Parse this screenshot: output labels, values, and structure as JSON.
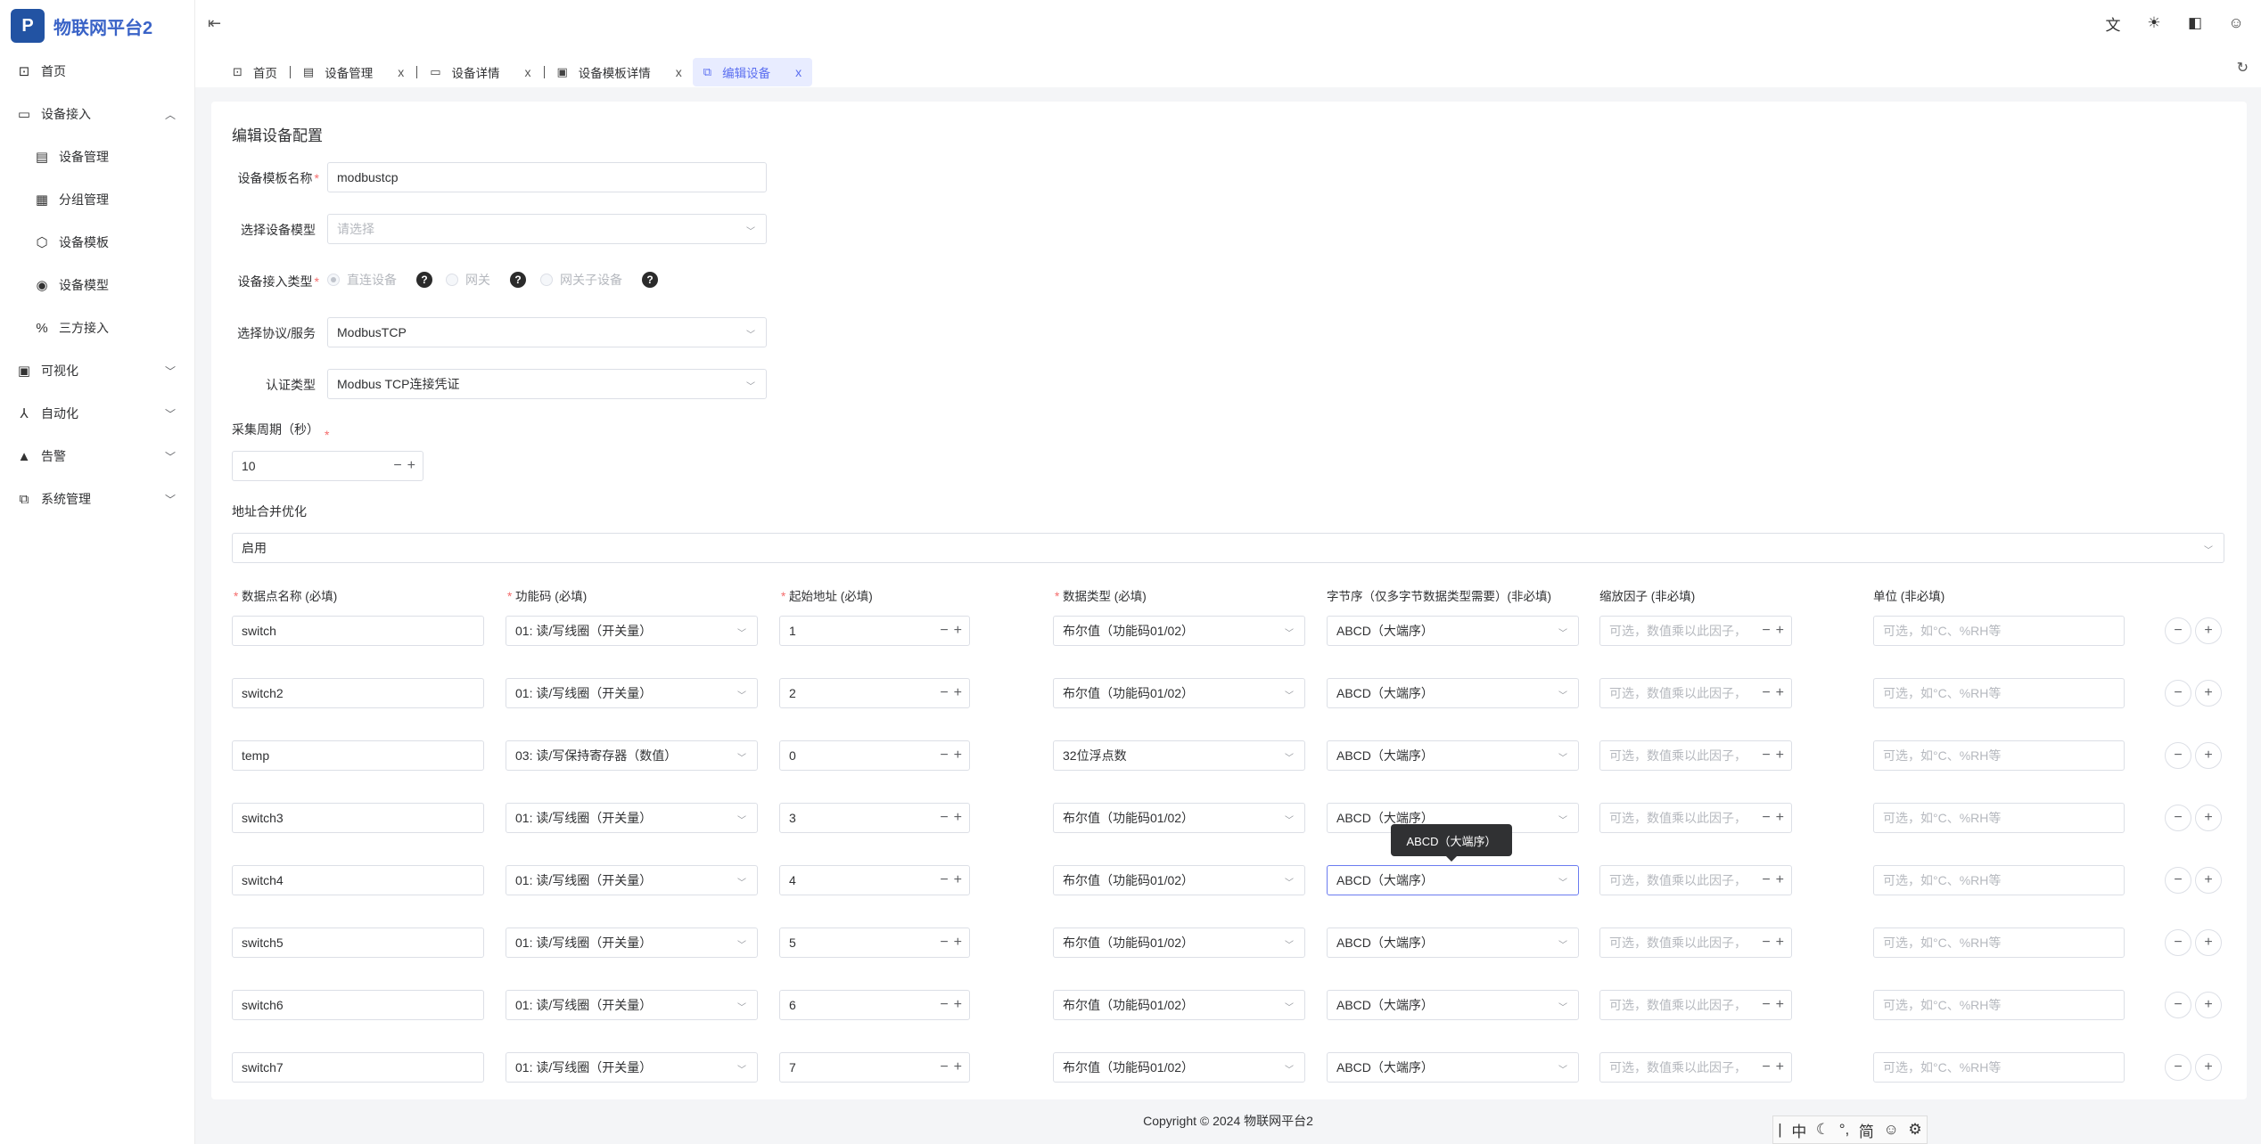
{
  "app": {
    "logo_glyph": "P",
    "title": "物联网平台2",
    "brand_color": "#3a63c7"
  },
  "sidebar": {
    "home": "首页",
    "device_access": "设备接入",
    "device_mgmt": "设备管理",
    "group_mgmt": "分组管理",
    "device_template": "设备模板",
    "device_model": "设备模型",
    "third_party": "三方接入",
    "visualization": "可视化",
    "automation": "自动化",
    "alarm": "告警",
    "system": "系统管理"
  },
  "tabs": [
    {
      "label": "首页",
      "icon": "home-icon"
    },
    {
      "label": "设备管理",
      "icon": "monitor-icon"
    },
    {
      "label": "设备详情",
      "icon": "device-icon"
    },
    {
      "label": "设备模板详情",
      "icon": "template-icon"
    },
    {
      "label": "编辑设备",
      "icon": "edit-device-icon"
    }
  ],
  "close_glyph": "x",
  "form": {
    "title": "编辑设备配置",
    "template_name_label": "设备模板名称",
    "template_name_value": "modbustcp",
    "model_label": "选择设备模型",
    "model_placeholder": "请选择",
    "access_type_label": "设备接入类型",
    "access_options": [
      "直连设备",
      "网关",
      "网关子设备"
    ],
    "protocol_label": "选择协议/服务",
    "protocol_value": "ModbusTCP",
    "auth_label": "认证类型",
    "auth_value": "Modbus TCP连接凭证",
    "period_label": "采集周期（秒）",
    "period_value": "10",
    "merge_label": "地址合并优化",
    "merge_value": "启用",
    "required_mark": "*",
    "help_glyph": "?"
  },
  "columns": {
    "name": "数据点名称 (必填)",
    "func": "功能码 (必填)",
    "addr": "起始地址 (必填)",
    "dtype": "数据类型 (必填)",
    "byteorder": "字节序（仅多字节数据类型需要）(非必填)",
    "scale": "缩放因子 (非必填)",
    "unit": "单位 (非必填)"
  },
  "placeholders": {
    "scale": "可选，数值乘以此因子，",
    "unit": "可选，如°C、%RH等"
  },
  "rows": [
    {
      "name": "switch",
      "func": "01: 读/写线圈（开关量）",
      "addr": "1",
      "dtype": "布尔值（功能码01/02）",
      "byteorder": "ABCD（大端序）"
    },
    {
      "name": "switch2",
      "func": "01: 读/写线圈（开关量）",
      "addr": "2",
      "dtype": "布尔值（功能码01/02）",
      "byteorder": "ABCD（大端序）"
    },
    {
      "name": "temp",
      "func": "03: 读/写保持寄存器（数值）",
      "addr": "0",
      "dtype": "32位浮点数",
      "byteorder": "ABCD（大端序）"
    },
    {
      "name": "switch3",
      "func": "01: 读/写线圈（开关量）",
      "addr": "3",
      "dtype": "布尔值（功能码01/02）",
      "byteorder": "ABCD（大端序）"
    },
    {
      "name": "switch4",
      "func": "01: 读/写线圈（开关量）",
      "addr": "4",
      "dtype": "布尔值（功能码01/02）",
      "byteorder": "ABCD（大端序）"
    },
    {
      "name": "switch5",
      "func": "01: 读/写线圈（开关量）",
      "addr": "5",
      "dtype": "布尔值（功能码01/02）",
      "byteorder": "ABCD（大端序）"
    },
    {
      "name": "switch6",
      "func": "01: 读/写线圈（开关量）",
      "addr": "6",
      "dtype": "布尔值（功能码01/02）",
      "byteorder": "ABCD（大端序）"
    },
    {
      "name": "switch7",
      "func": "01: 读/写线圈（开关量）",
      "addr": "7",
      "dtype": "布尔值（功能码01/02）",
      "byteorder": "ABCD（大端序）"
    }
  ],
  "tooltip": "ABCD（大端序）",
  "footer": "Copyright © 2024 物联网平台2",
  "ime": [
    "中",
    "简"
  ]
}
